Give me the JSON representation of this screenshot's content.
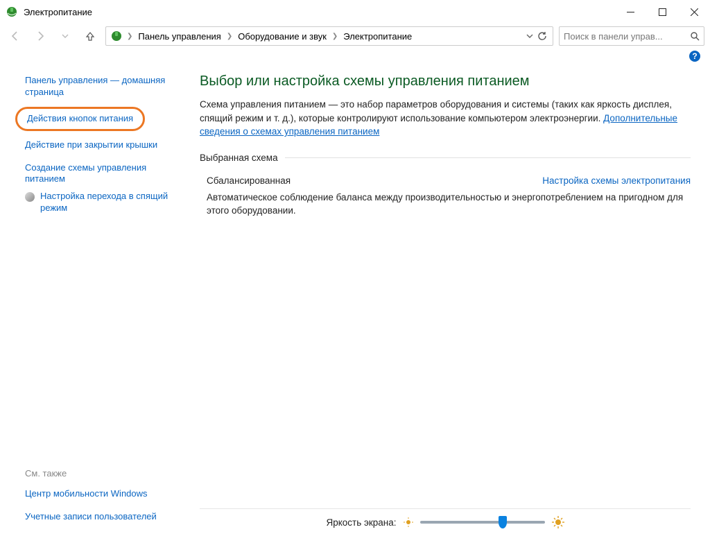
{
  "window": {
    "title": "Электропитание"
  },
  "breadcrumbs": {
    "items": [
      "Панель управления",
      "Оборудование и звук",
      "Электропитание"
    ]
  },
  "search": {
    "placeholder": "Поиск в панели управ..."
  },
  "sidebar": {
    "home": "Панель управления — домашняя страница",
    "items": [
      "Действия кнопок питания",
      "Действие при закрытии крышки",
      "Создание схемы управления питанием",
      "Настройка перехода в спящий режим"
    ],
    "seealso_label": "См. также",
    "seealso": [
      "Центр мобильности Windows",
      "Учетные записи пользователей"
    ]
  },
  "main": {
    "heading": "Выбор или настройка схемы управления питанием",
    "description_pre": "Схема управления питанием — это набор параметров оборудования и системы (таких как яркость дисплея, спящий режим и т. д.), которые контролируют использование компьютером электроэнергии. ",
    "description_link": "Дополнительные сведения о схемах управления питанием",
    "section_label": "Выбранная схема",
    "plan_name": "Сбалансированная",
    "plan_settings_link": "Настройка схемы электропитания",
    "plan_desc": "Автоматическое соблюдение баланса между производительностью и энергопотреблением на пригодном для этого оборудовании.",
    "brightness_label": "Яркость экрана:"
  }
}
